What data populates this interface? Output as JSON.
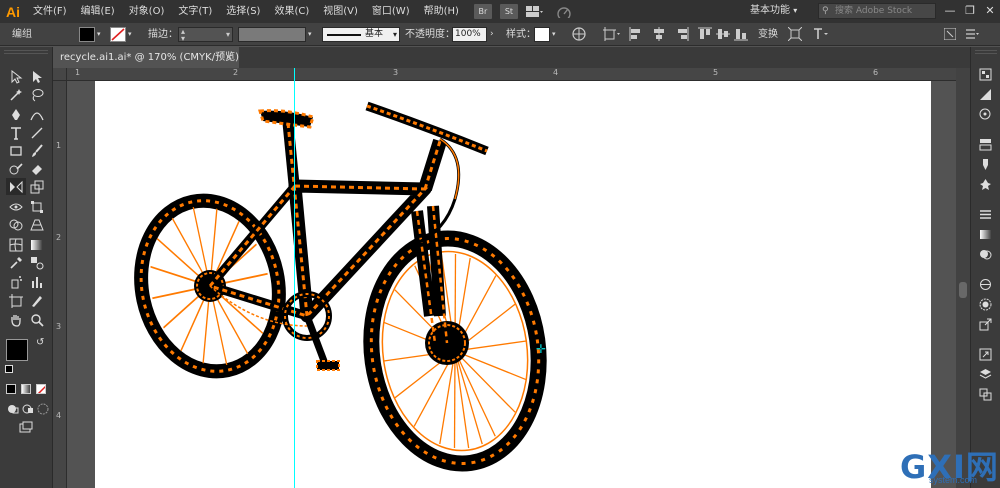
{
  "app": {
    "logo": "Ai"
  },
  "menu": [
    "文件(F)",
    "编辑(E)",
    "对象(O)",
    "文字(T)",
    "选择(S)",
    "效果(C)",
    "视图(V)",
    "窗口(W)",
    "帮助(H)"
  ],
  "bridge": {
    "br": "Br",
    "st": "St"
  },
  "workspace": "基本功能",
  "search": {
    "placeholder": "搜索 Adobe Stock"
  },
  "window_controls": {
    "minimize": "—",
    "restore": "❐",
    "close": "✕"
  },
  "control": {
    "selection": "编组",
    "stroke_label": "描边：",
    "stroke_style": "基本",
    "opacity_label": "不透明度：",
    "opacity_value": "100%",
    "style_label": "样式：",
    "transform_label": "变换"
  },
  "document": {
    "tab_title": "recycle.ai1.ai* @ 170% (CMYK/预览)",
    "close": "×"
  },
  "ruler": {
    "top_numbers": [
      "1",
      "2",
      "3",
      "4",
      "5",
      "6"
    ],
    "left_numbers": [
      "1",
      "2",
      "3",
      "4"
    ]
  },
  "watermark": {
    "big": "GXI网",
    "small": "system.com"
  },
  "colors": {
    "accent_logo": "#ff9a00",
    "selection_orange": "#ff7a00",
    "guide": "#00ffff",
    "artboard": "#ffffff",
    "bike": "#000000",
    "watermark": "#2e6fb7"
  }
}
